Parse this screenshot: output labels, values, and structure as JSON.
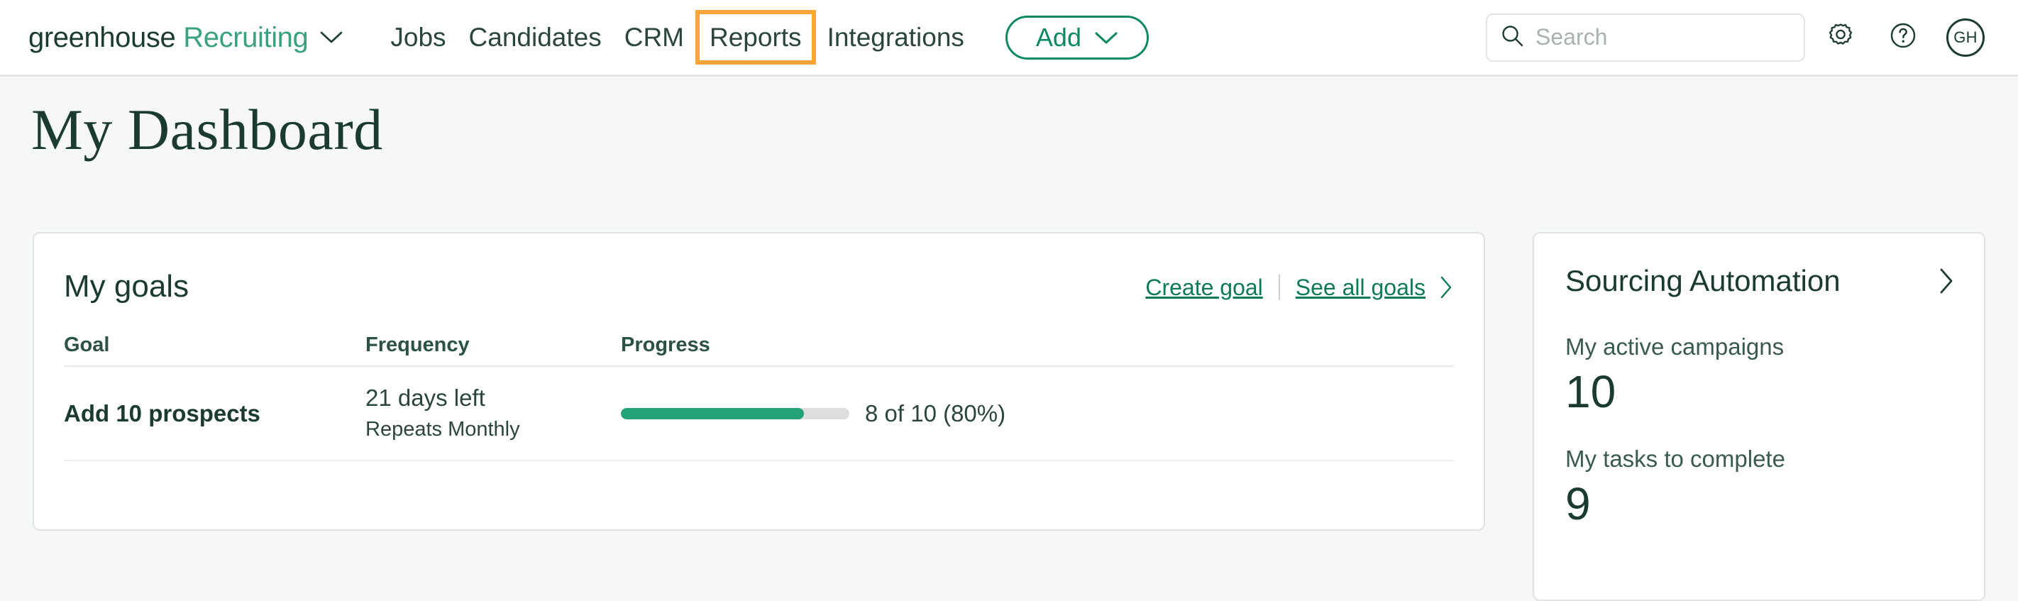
{
  "header": {
    "brand": {
      "word1": "greenhouse",
      "word2": "Recruiting",
      "chevron_icon": "chevron-down-icon"
    },
    "nav_items": [
      {
        "label": "Jobs",
        "highlighted": false
      },
      {
        "label": "Candidates",
        "highlighted": false
      },
      {
        "label": "CRM",
        "highlighted": false
      },
      {
        "label": "Reports",
        "highlighted": true
      },
      {
        "label": "Integrations",
        "highlighted": false
      }
    ],
    "add_button": {
      "label": "Add",
      "chevron_icon": "chevron-down-icon"
    },
    "search": {
      "value": "",
      "placeholder": "Search",
      "icon": "search-icon"
    },
    "settings_icon": "gear-icon",
    "help_icon": "question-circle-icon",
    "avatar": {
      "initials": "GH"
    },
    "highlight_color": "#fca53b"
  },
  "page": {
    "title": "My Dashboard"
  },
  "goals_card": {
    "title": "My goals",
    "create_link": "Create goal",
    "see_all_link": "See all goals",
    "see_all_chevron_icon": "chevron-right-icon",
    "columns": [
      "Goal",
      "Frequency",
      "Progress"
    ],
    "rows": [
      {
        "goal": "Add 10 prospects",
        "frequency_main": "21 days left",
        "frequency_sub": "Repeats Monthly",
        "progress_percent": 80,
        "progress_label": "8 of 10 (80%)"
      }
    ]
  },
  "sourcing_card": {
    "title": "Sourcing Automation",
    "chevron_icon": "chevron-right-icon",
    "stats": [
      {
        "label": "My active campaigns",
        "value": "10"
      },
      {
        "label": "My tasks to complete",
        "value": "9"
      }
    ]
  },
  "colors": {
    "brand_dark_green": "#1b3a30",
    "brand_green": "#3aa27e",
    "link_green": "#0e7a58",
    "progress_green": "#23a27a",
    "highlight_orange": "#fca53b",
    "page_background": "#f6f7f7"
  }
}
